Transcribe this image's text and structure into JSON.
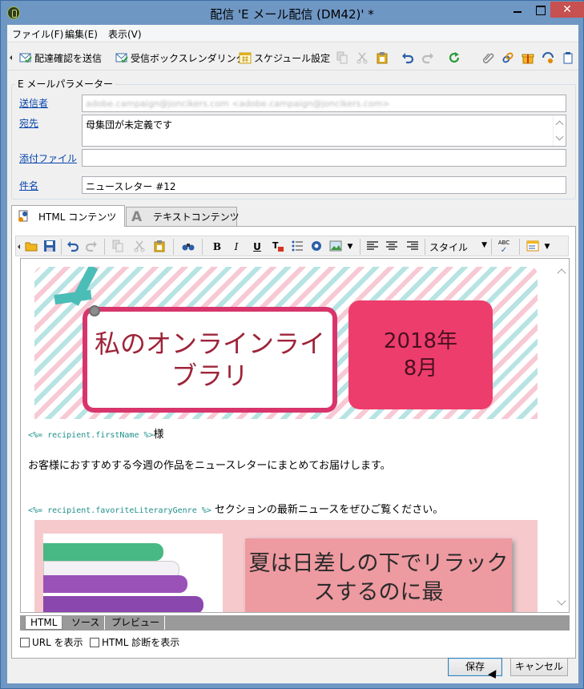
{
  "window": {
    "title": "配信 'E メール配信 (DM42)' *",
    "close_glyph": "✕"
  },
  "menu": [
    "ファイル(F)",
    "編集(E)",
    "表示(V)"
  ],
  "toolbar": {
    "send_proof": "配達確認を送信",
    "inbox_rendering": "受信ボックスレンダリング",
    "schedule": "スケジュール設定"
  },
  "params": {
    "group_title": "E メールパラメーター",
    "from_label": "送信者",
    "from_value": "adobe.campaign@joncikers.com <adobe.campaign@joncikers.com>",
    "to_label": "宛先",
    "to_value": "母集団が未定義です",
    "attach_label": "添付ファイル",
    "attach_value": "",
    "subject_label": "件名",
    "subject_value": "ニュースレター #12"
  },
  "tabs": {
    "html": "HTML コンテンツ",
    "text": "テキストコンテンツ"
  },
  "editor_toolbar": {
    "style_label": "スタイル",
    "bold": "B",
    "italic": "I",
    "underline": "U",
    "spell": "ABC"
  },
  "content": {
    "banner_title": "私のオンラインライブラリ",
    "banner_date": "2018年\n8月",
    "greeting_code": "<%= recipient.firstName %>",
    "greeting_suffix": "様",
    "intro": "お客様におすすめする今週の作品をニュースレターにまとめてお届けします。",
    "genre_code": "<%= recipient.favoriteLiteraryGenre %>",
    "genre_suffix": " セクションの最新ニュースをぜひご覧ください。",
    "feature_title": "夏は日差しの下でリラックスするのに最"
  },
  "view_tabs": [
    "HTML",
    "ソース",
    "プレビュー"
  ],
  "options": {
    "show_url": "URL を表示",
    "show_diag": "HTML 診断を表示"
  },
  "buttons": {
    "save": "保存",
    "cancel": "キャンセル"
  },
  "colors": {
    "accent_pink": "#ed3d6c",
    "title_text": "#9e2439",
    "code_teal": "#1f8f8a",
    "link_blue": "#0645ad"
  }
}
